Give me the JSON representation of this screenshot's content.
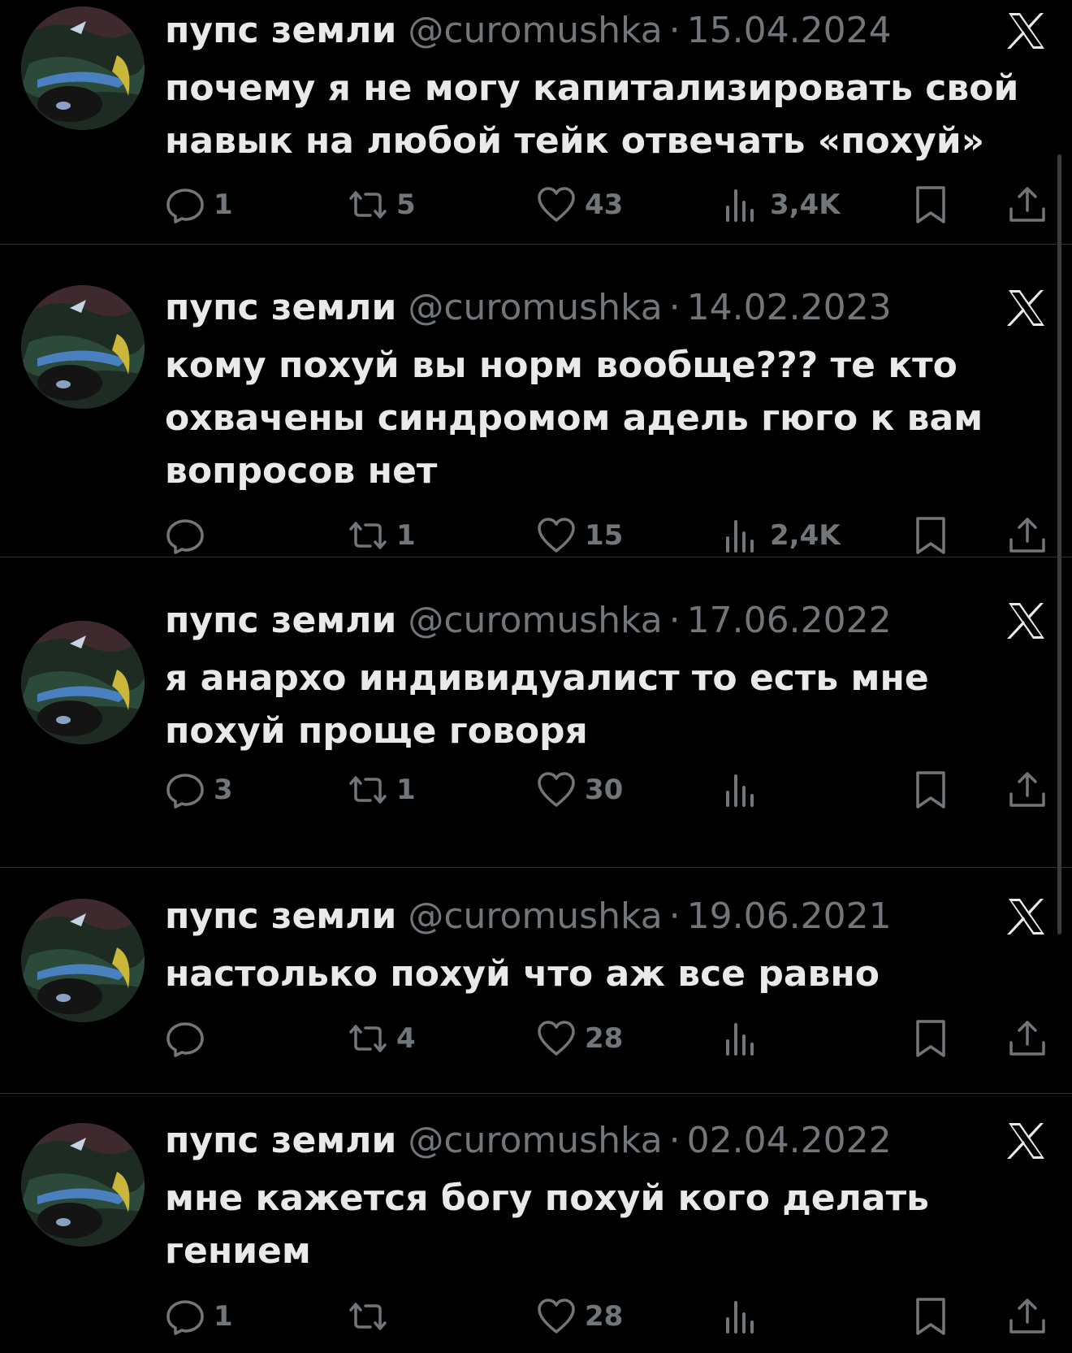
{
  "tweets": [
    {
      "name": "пупс земли",
      "handle": "@curomushka",
      "separator": "·",
      "date": "15.04.2024",
      "text": "почему я не могу капитализировать свой навык на любой тейк отвечать «похуй»",
      "replies": "1",
      "retweets": "5",
      "likes": "43",
      "views": "3,4K"
    },
    {
      "name": "пупс земли",
      "handle": "@curomushka",
      "separator": "·",
      "date": "14.02.2023",
      "text": "кому похуй вы норм вообще??? те кто охвачены синдромом адель гюго к вам вопросов нет",
      "replies": "",
      "retweets": "1",
      "likes": "15",
      "views": "2,4K"
    },
    {
      "name": "пупс земли",
      "handle": "@curomushka",
      "separator": "·",
      "date": "17.06.2022",
      "text": "я анархо индивидуалист то есть мне похуй проще говоря",
      "replies": "3",
      "retweets": "1",
      "likes": "30",
      "views": ""
    },
    {
      "name": "пупс земли",
      "handle": "@curomushka",
      "separator": "·",
      "date": "19.06.2021",
      "text": "настолько похуй что аж все равно",
      "replies": "",
      "retweets": "4",
      "likes": "28",
      "views": ""
    },
    {
      "name": "пупс земли",
      "handle": "@curomushka",
      "separator": "·",
      "date": "02.04.2022",
      "text": "мне кажется богу похуй кого делать гением",
      "replies": "1",
      "retweets": "",
      "likes": "28",
      "views": ""
    }
  ],
  "icons": {
    "avatar": "avatar-image",
    "platform": "x-logo-icon",
    "reply": "reply-icon",
    "retweet": "retweet-icon",
    "like": "heart-icon",
    "views": "views-icon",
    "bookmark": "bookmark-icon",
    "share": "share-icon"
  },
  "colors": {
    "background": "#000000",
    "text": "#e7e9ea",
    "secondary": "#71767b",
    "divider": "#2f3336"
  }
}
